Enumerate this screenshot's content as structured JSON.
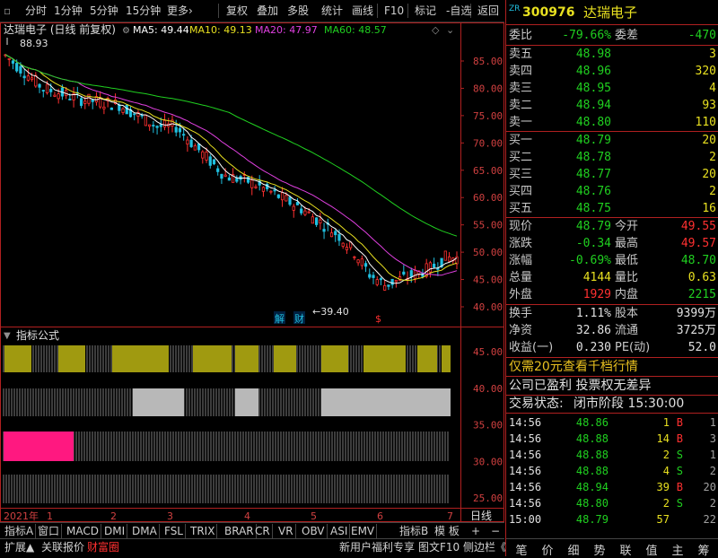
{
  "toolbar": {
    "items": [
      "分时",
      "1分钟",
      "5分钟",
      "15分钟",
      "更多›",
      "复权",
      "叠加",
      "多股",
      "统计",
      "画线",
      "F10",
      "标记",
      "-自选",
      "返回"
    ]
  },
  "chart": {
    "title": "达瑞电子 (日线 前复权)",
    "ma": [
      {
        "label": "MA5: 49.44",
        "color": "#ffffff"
      },
      {
        "label": "MA10: 49.13",
        "color": "#e8e020"
      },
      {
        "label": "MA20: 47.97",
        "color": "#e040e0"
      },
      {
        "label": "MA60: 48.57",
        "color": "#20d020"
      }
    ],
    "high_label": "88.93",
    "low_label": "39.40",
    "y_labels": [
      "85.00",
      "80.00",
      "75.00",
      "70.00",
      "65.00",
      "60.00",
      "55.00",
      "50.00",
      "45.00",
      "40.00"
    ],
    "markers": [
      "解",
      "财",
      "$"
    ],
    "indicator_title": "指标公式",
    "indicator_y_labels": [
      "45.00",
      "40.00",
      "35.00",
      "30.00",
      "25.00"
    ],
    "x_labels": [
      "2021年",
      "1",
      "2",
      "3",
      "4",
      "5",
      "6",
      "7"
    ],
    "period_label": "日线"
  },
  "chart_data": {
    "type": "candlestick",
    "ylim": [
      38,
      88
    ],
    "note_series": [
      "MA5",
      "MA10",
      "MA20",
      "MA60"
    ]
  },
  "tabs1": [
    "指标A",
    "窗口",
    "MACD",
    "DMI",
    "DMA",
    "FSL",
    "TRIX",
    "BRAR",
    "CR",
    "VR",
    "OBV",
    "ASI",
    "EMV",
    "指标B",
    "模 板",
    "+",
    "−"
  ],
  "tabs2": [
    "扩展▲",
    "关联报价",
    "财富圈",
    "新用户福利专享",
    "图文F10",
    "侧边栏《"
  ],
  "stock": {
    "code_prefix": "ZR",
    "code": "300976",
    "name": "达瑞电子"
  },
  "panel": {
    "weibi": {
      "l": "委比",
      "v": "-79.66%",
      "l2": "委差",
      "v2": "-470"
    },
    "sells": [
      {
        "l": "卖五",
        "p": "48.98",
        "q": "3"
      },
      {
        "l": "卖四",
        "p": "48.96",
        "q": "320"
      },
      {
        "l": "卖三",
        "p": "48.95",
        "q": "4"
      },
      {
        "l": "卖二",
        "p": "48.94",
        "q": "93"
      },
      {
        "l": "卖一",
        "p": "48.80",
        "q": "110"
      }
    ],
    "buys": [
      {
        "l": "买一",
        "p": "48.79",
        "q": "20"
      },
      {
        "l": "买二",
        "p": "48.78",
        "q": "2"
      },
      {
        "l": "买三",
        "p": "48.77",
        "q": "20"
      },
      {
        "l": "买四",
        "p": "48.76",
        "q": "2"
      },
      {
        "l": "买五",
        "p": "48.75",
        "q": "16"
      }
    ],
    "quote": [
      {
        "l": "现价",
        "v": "48.79",
        "l2": "今开",
        "v2": "49.55"
      },
      {
        "l": "涨跌",
        "v": "-0.34",
        "l2": "最高",
        "v2": "49.57"
      },
      {
        "l": "涨幅",
        "v": "-0.69%",
        "l2": "最低",
        "v2": "48.70"
      },
      {
        "l": "总量",
        "v": "4144",
        "l2": "量比",
        "v2": "0.63"
      },
      {
        "l": "外盘",
        "v": "1929",
        "l2": "内盘",
        "v2": "2215"
      }
    ],
    "stats": [
      {
        "l": "换手",
        "v": "1.11%",
        "l2": "股本",
        "v2": "9399万"
      },
      {
        "l": "净资",
        "v": "32.86",
        "l2": "流通",
        "v2": "3725万"
      },
      {
        "l": "收益(一)",
        "v": "0.230",
        "l2": "PE(动)",
        "v2": "52.0"
      }
    ],
    "promo": "仅需20元查看千档行情",
    "info": "公司已盈利 投票权无差异",
    "status_label": "交易状态:",
    "status_value": "闭市阶段 15:30:00",
    "trades": [
      {
        "t": "14:56",
        "p": "48.86",
        "q": "1",
        "s": "B",
        "n": "1"
      },
      {
        "t": "14:56",
        "p": "48.88",
        "q": "14",
        "s": "B",
        "n": "3"
      },
      {
        "t": "14:56",
        "p": "48.88",
        "q": "2",
        "s": "S",
        "n": "1"
      },
      {
        "t": "14:56",
        "p": "48.88",
        "q": "4",
        "s": "S",
        "n": "2"
      },
      {
        "t": "14:56",
        "p": "48.94",
        "q": "39",
        "s": "B",
        "n": "20"
      },
      {
        "t": "14:56",
        "p": "48.80",
        "q": "2",
        "s": "S",
        "n": "2"
      },
      {
        "t": "15:00",
        "p": "48.79",
        "q": "57",
        "s": "",
        "n": "22"
      }
    ],
    "bottom_tabs": [
      "笔",
      "价",
      "细",
      "势",
      "联",
      "值",
      "主",
      "筹"
    ]
  }
}
